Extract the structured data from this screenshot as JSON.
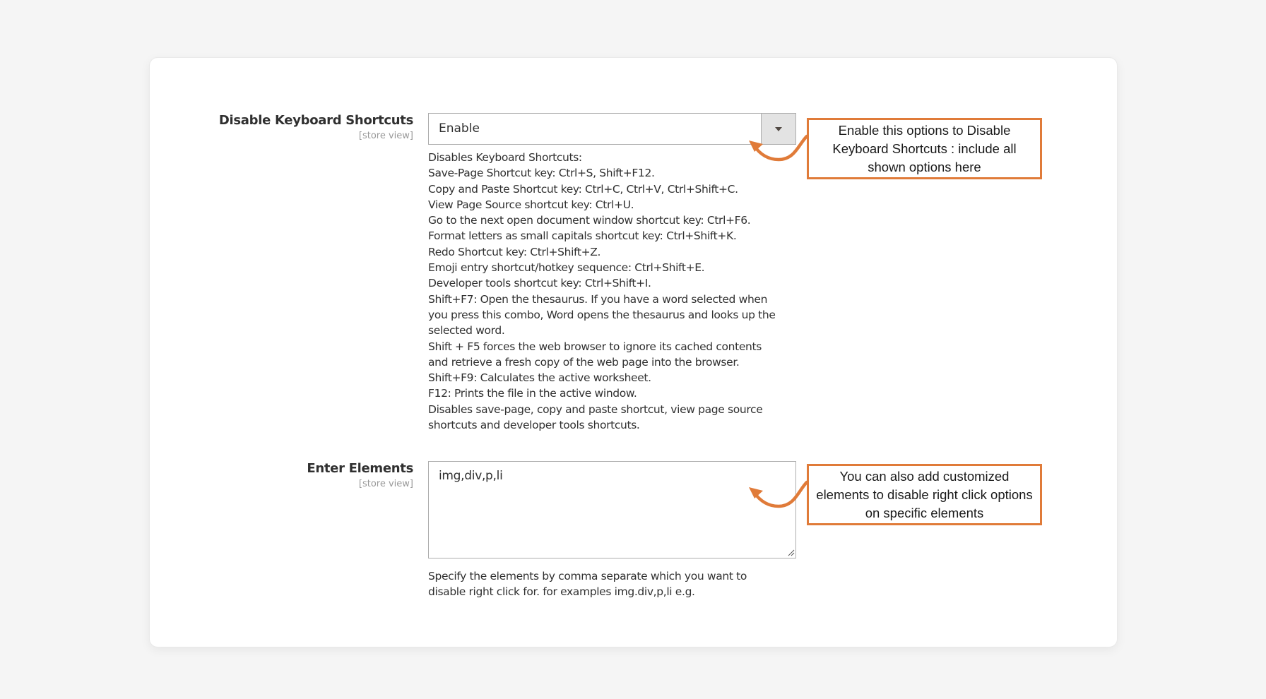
{
  "fields": [
    {
      "label": "Disable Keyboard Shortcuts",
      "scope": "[store view]",
      "control": "select",
      "selected_value": "Enable",
      "note_lines": [
        "Disables Keyboard Shortcuts:",
        "Save-Page Shortcut key: Ctrl+S, Shift+F12.",
        "Copy and Paste Shortcut key: Ctrl+C, Ctrl+V, Ctrl+Shift+C.",
        "View Page Source shortcut key: Ctrl+U.",
        "Go to the next open document window shortcut key: Ctrl+F6.",
        "Format letters as small capitals shortcut key: Ctrl+Shift+K.",
        "Redo Shortcut key: Ctrl+Shift+Z.",
        "Emoji entry shortcut/hotkey sequence: Ctrl+Shift+E.",
        "Developer tools shortcut key: Ctrl+Shift+I.",
        "Shift+F7: Open the thesaurus. If you have a word selected when",
        "you press this combo, Word opens the thesaurus and looks up the",
        "selected word.",
        "Shift + F5 forces the web browser to ignore its cached contents",
        "and retrieve a fresh copy of the web page into the browser.",
        "Shift+F9: Calculates the active worksheet.",
        "F12: Prints the file in the active window.",
        "Disables save-page, copy and paste shortcut, view page source",
        "shortcuts and developer tools shortcuts."
      ]
    },
    {
      "label": "Enter Elements",
      "scope": "[store view]",
      "control": "textarea",
      "value": "img,div,p,li",
      "note_lines": [
        "Specify the elements by comma separate which you want to",
        "disable right click for. for examples img.div,p,li e.g."
      ]
    }
  ],
  "callouts": [
    {
      "text": "Enable this options to Disable Keyboard Shortcuts : include all shown options here"
    },
    {
      "text": "You can also add customized elements to disable right click options on specific elements"
    }
  ],
  "colors": {
    "annotation_orange": "#e07b39",
    "background": "#f5f5f5",
    "card": "#ffffff"
  },
  "icons": {
    "dropdown": "chevron-down-icon",
    "resize": "resize-grip-icon",
    "annotation_arrow": "curved-arrow-icon"
  }
}
